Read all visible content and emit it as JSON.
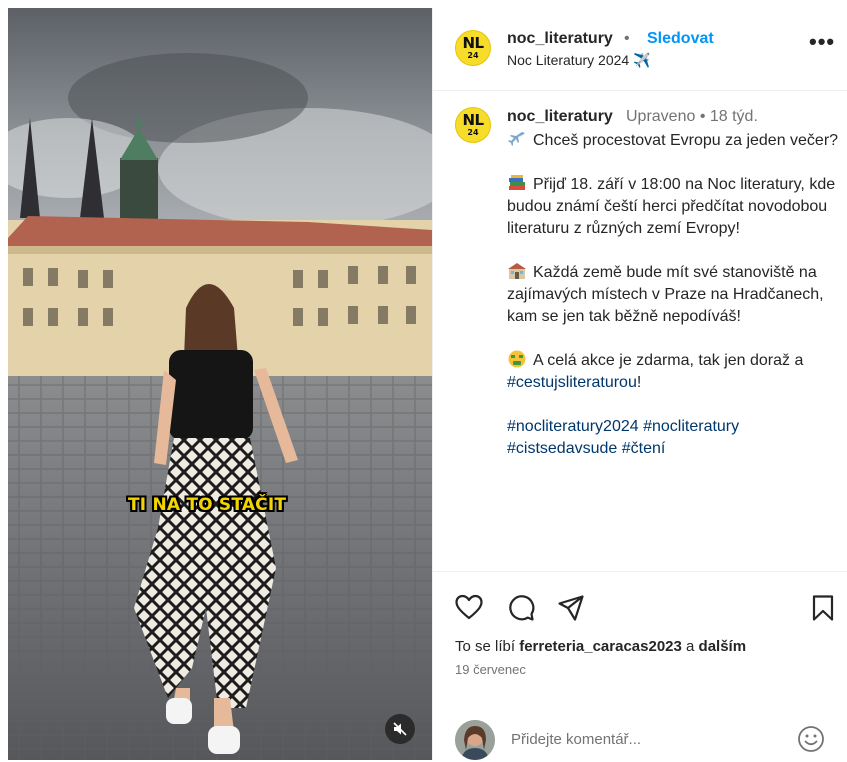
{
  "media": {
    "overlay_caption": "TI NA TO STAČIT",
    "mute_icon": "speaker-muted-icon"
  },
  "header": {
    "avatar_text": "NL",
    "avatar_number": "24",
    "username": "noc_literatury",
    "separator": "•",
    "follow_label": "Sledovat",
    "subtitle": "Noc Literatury 2024 ✈️",
    "more_label": "•••"
  },
  "caption": {
    "username": "noc_literatury",
    "meta": "Upraveno • 18 týd.",
    "line1": "Chceš procestovat Evropu za jeden večer?",
    "line2": "Přijď 18. září v 18:00 na Noc literatury, kde budou známí čeští herci předčítat novodobou literaturu z různých zemí Evropy!",
    "line3": "Každá země bude mít své stanoviště na zajímavých místech v Praze na Hradčanech, kam se jen tak běžně nepodíváš!",
    "line4_text": "A celá akce je zdarma, tak jen doraž a",
    "line4_tag": "#cestujsliteraturou",
    "line4_end": "!",
    "tags_line1": "#nocliteratury2024 #nocliteratury",
    "tags_line2": "#cistsedavsude #čtení",
    "emoji": [
      "airplane-emoji",
      "books-emoji",
      "house-emoji",
      "money-mouth-face-emoji"
    ]
  },
  "actions": {
    "icons": [
      "heart-icon",
      "comment-icon",
      "share-icon",
      "bookmark-icon"
    ],
    "likes_prefix": "To se líbí",
    "likes_user": "ferreteria_caracas2023",
    "likes_mid": "a",
    "likes_others": "dalším",
    "date": "19 červenec",
    "comment_placeholder": "Přidejte komentář...",
    "emoji_icon": "smiley-icon"
  }
}
